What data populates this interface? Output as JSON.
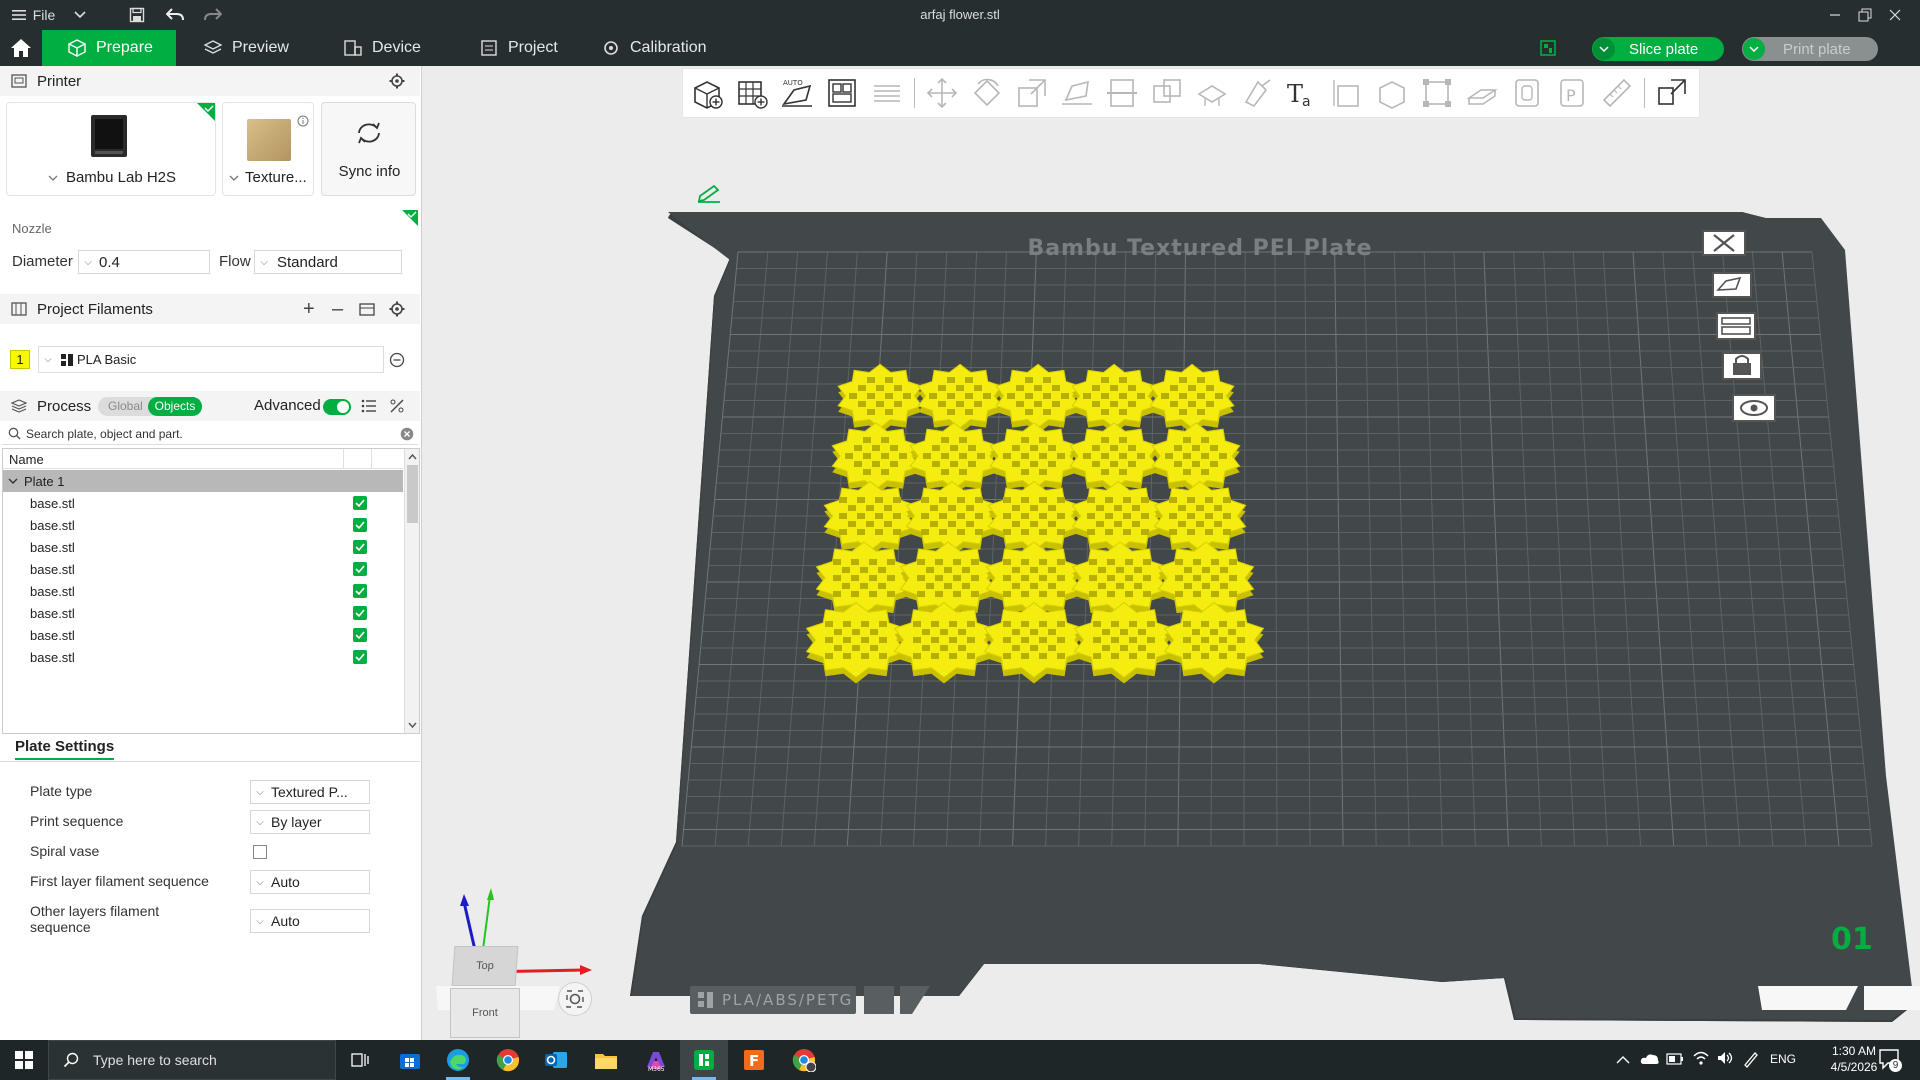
{
  "titlebar": {
    "file_label": "File",
    "window_title": "arfaj flower.stl"
  },
  "tabs": [
    {
      "label": "Prepare",
      "active": true
    },
    {
      "label": "Preview",
      "active": false
    },
    {
      "label": "Device",
      "active": false
    },
    {
      "label": "Project",
      "active": false
    },
    {
      "label": "Calibration",
      "active": false
    }
  ],
  "actions": {
    "slice_label": "Slice plate",
    "print_label": "Print plate"
  },
  "printer": {
    "section_title": "Printer",
    "printer_name": "Bambu Lab H2S",
    "plate_name": "Texture...",
    "sync_label": "Sync info",
    "nozzle_title": "Nozzle",
    "diameter_label": "Diameter",
    "diameter_value": "0.4",
    "flow_label": "Flow",
    "flow_value": "Standard"
  },
  "filaments": {
    "section_title": "Project Filaments",
    "items": [
      {
        "index": "1",
        "name": "PLA Basic",
        "color": "#f7f700"
      }
    ]
  },
  "process": {
    "section_title": "Process",
    "global_label": "Global",
    "objects_label": "Objects",
    "advanced_label": "Advanced",
    "search_placeholder": "Search plate, object and part.",
    "column_name": "Name",
    "plate_label": "Plate 1",
    "objects": [
      "base.stl",
      "base.stl",
      "base.stl",
      "base.stl",
      "base.stl",
      "base.stl",
      "base.stl",
      "base.stl"
    ]
  },
  "plate_settings": {
    "tab_label": "Plate Settings",
    "plate_type_label": "Plate type",
    "plate_type_value": "Textured P...",
    "print_sequence_label": "Print sequence",
    "print_sequence_value": "By layer",
    "spiral_vase_label": "Spiral vase",
    "spiral_vase_checked": false,
    "first_layer_label": "First layer filament sequence",
    "first_layer_value": "Auto",
    "other_layers_label_1": "Other layers filament",
    "other_layers_label_2": "sequence",
    "other_layers_value": "Auto"
  },
  "viewport": {
    "plate_title": "Bambu Textured PEI Plate",
    "plate_bottom_label": "PLA/ABS/PETG",
    "plate_number": "01",
    "view_top": "Top",
    "view_front": "Front",
    "object_color": "#f5ec10",
    "bed_color": "#3f4446",
    "object_grid": "5 × 5 flowers"
  },
  "taskbar": {
    "search_placeholder": "Type here to search",
    "lang": "ENG",
    "time": "1:30 AM",
    "date": "4/5/2026",
    "notifications": "9"
  },
  "colors": {
    "accent": "#00ae42",
    "titlebar": "#262e30"
  }
}
